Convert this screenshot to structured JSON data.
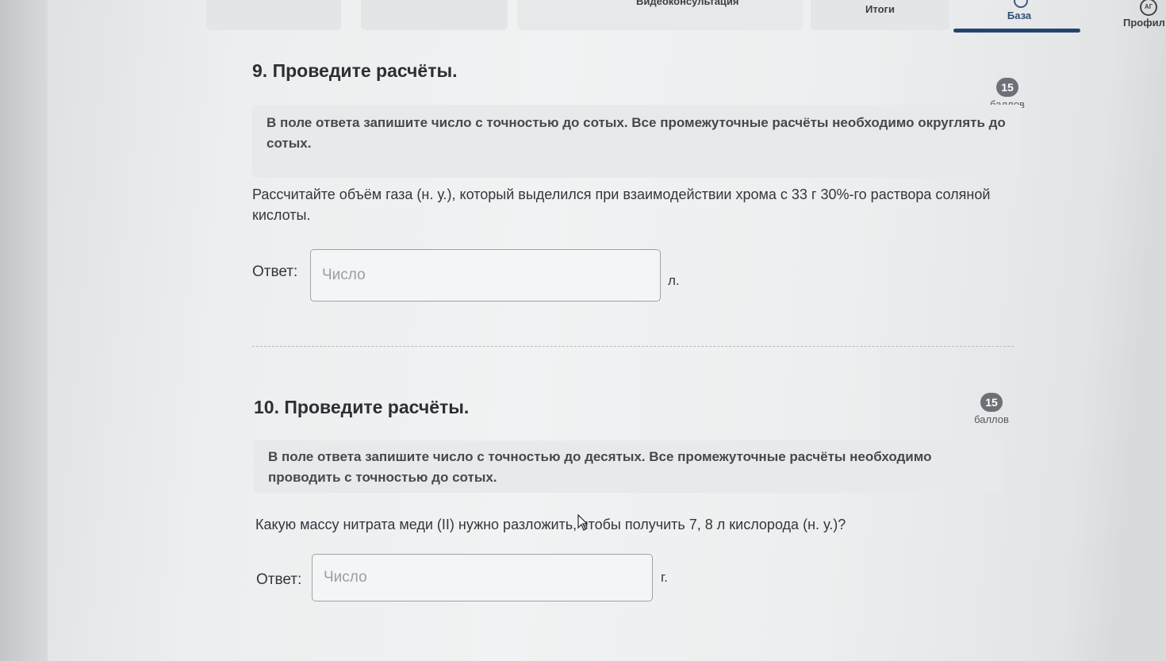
{
  "nav": {
    "tabs": [
      {
        "label": ""
      },
      {
        "label": ""
      },
      {
        "label": "Видеоконсультация"
      },
      {
        "label": "Итоги"
      },
      {
        "label": "База"
      },
      {
        "label": "Профил"
      }
    ],
    "active_tab": "База",
    "profile_icon_text": "АГ"
  },
  "tasks": [
    {
      "title": "9. Проведите расчёты.",
      "score_value": "15",
      "score_label": "баллов",
      "hint": "В поле ответа запишите число с точностью до сотых. Все промежуточные расчёты необходимо округлять до сотых.",
      "question": "Рассчитайте объём газа (н. у.), который выделился при взаимодействии хрома с 33 г 30%-го раствора соляной кислоты.",
      "answer_label": "Ответ:",
      "answer_value": "",
      "answer_placeholder": "Число",
      "unit": "л."
    },
    {
      "title": "10. Проведите расчёты.",
      "score_value": "15",
      "score_label": "баллов",
      "hint": "В поле ответа запишите число с точностью до десятых. Все промежуточные расчёты необходимо проводить с точностью до сотых.",
      "question": "Какую массу нитрата меди (II) нужно разложить, чтобы получить 7, 8 л кислорода (н. у.)?",
      "answer_label": "Ответ:",
      "answer_value": "",
      "answer_placeholder": "Число",
      "unit": "г."
    }
  ],
  "colors": {
    "accent": "#23456e",
    "badge": "#6d7177",
    "hint_bg": "#e7e9eb"
  }
}
